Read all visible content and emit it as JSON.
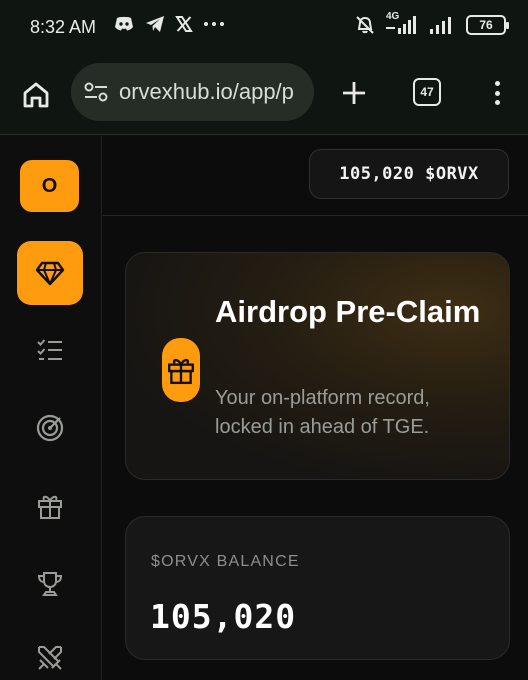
{
  "status_bar": {
    "time": "8:32 AM",
    "icons": [
      "discord-icon",
      "telegram-icon",
      "x-icon",
      "more-dots-icon"
    ],
    "signal_label": "4G",
    "battery": "76"
  },
  "browser": {
    "url": "orvexhub.io/app/p",
    "tab_count": "47"
  },
  "sidebar": {
    "avatar_initial": "O",
    "items": [
      {
        "icon": "diamond-icon",
        "active": true
      },
      {
        "icon": "checklist-icon",
        "active": false
      },
      {
        "icon": "radar-icon",
        "active": false
      },
      {
        "icon": "gift-icon",
        "active": false
      },
      {
        "icon": "trophy-icon",
        "active": false
      },
      {
        "icon": "swords-icon",
        "active": false
      }
    ]
  },
  "header": {
    "balance_pill": "105,020 $ORVX"
  },
  "hero": {
    "title": "Airdrop Pre-Claim",
    "subtitle": "Your on-platform record, locked in ahead of TGE."
  },
  "balance_card": {
    "label": "$ORVX BALANCE",
    "value": "105,020"
  },
  "colors": {
    "accent": "#ff9b0f",
    "background": "#0b0c0b",
    "card": "#161716",
    "muted_text": "#9a9c98"
  }
}
